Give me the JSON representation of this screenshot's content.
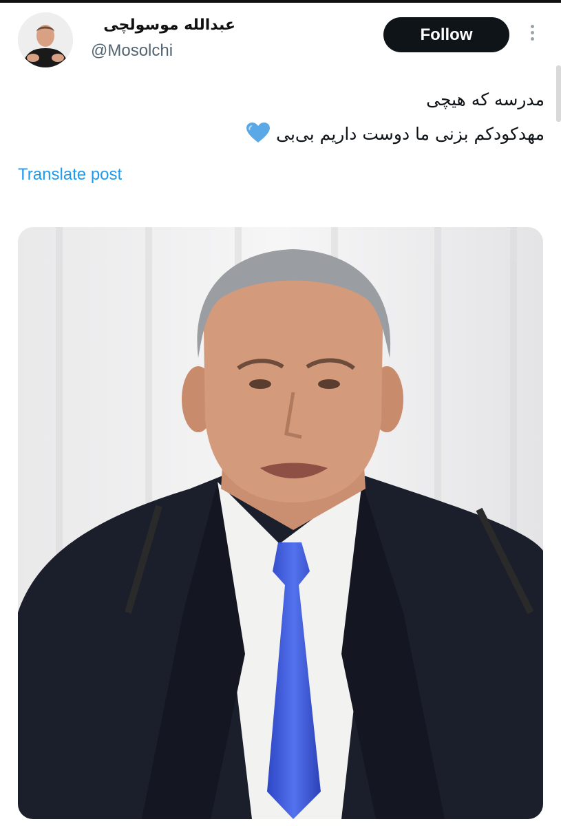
{
  "account": {
    "display_name": "عبدالله موسولچی",
    "handle": "@Mosolchi"
  },
  "follow_label": "Follow",
  "post": {
    "line1": "مدرسه که هیچی",
    "line2": "مهدکودکم بزنی ما دوست داریم بی‌بی",
    "emoji": "💙"
  },
  "translate_label": "Translate post",
  "icons": {
    "more": "more-vertical-icon",
    "heart": "blue-heart-emoji"
  },
  "colors": {
    "follow_bg": "#0f1419",
    "link": "#1d9bf0",
    "handle": "#536471",
    "tie": "#3f5fe0"
  }
}
